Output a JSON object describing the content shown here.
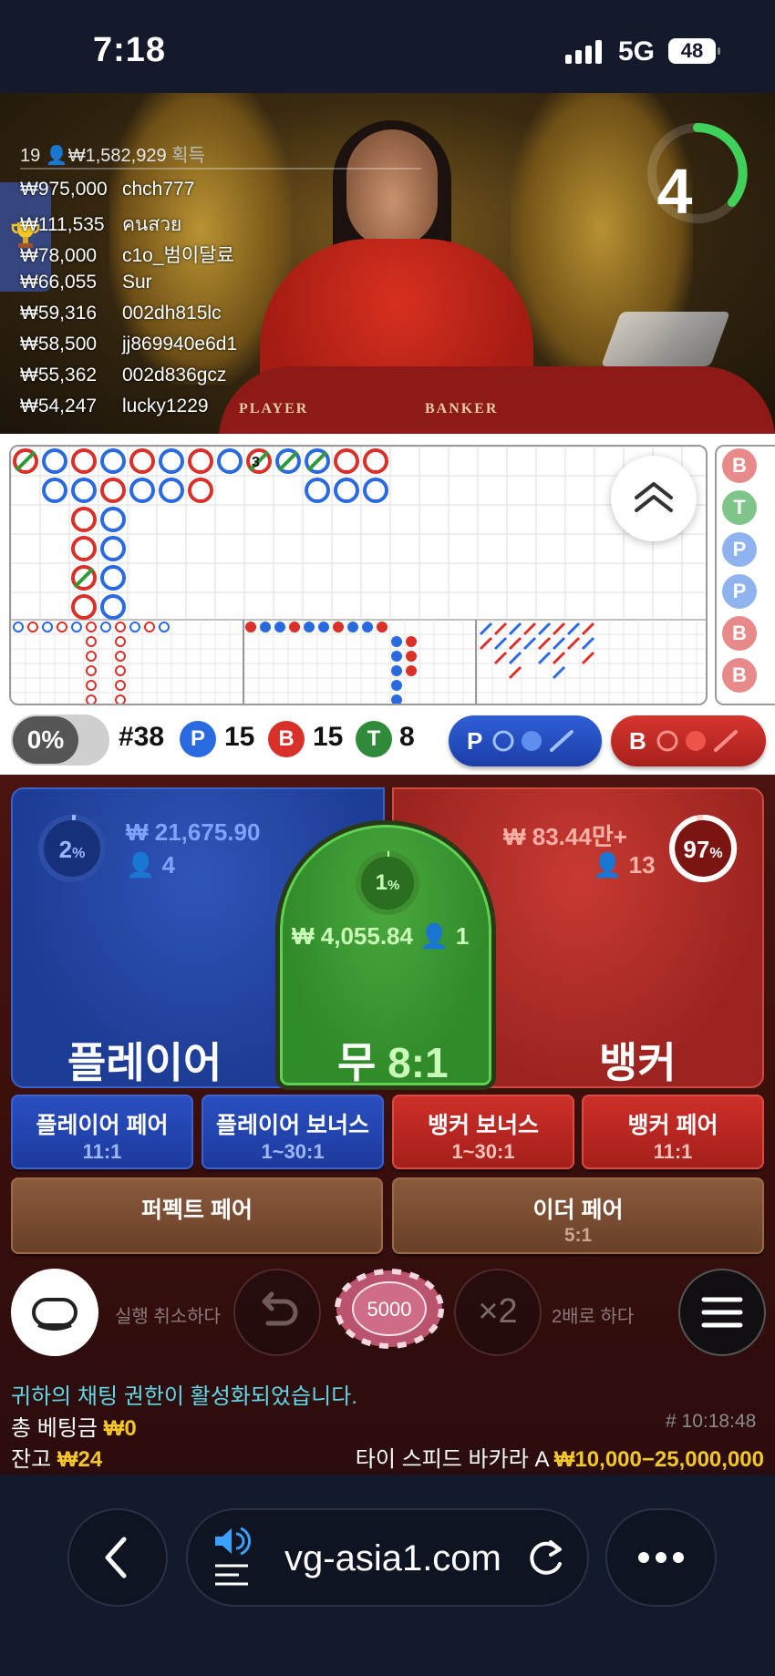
{
  "status_bar": {
    "time": "7:18",
    "network": "5G",
    "battery": "48"
  },
  "video": {
    "winners_header": {
      "count": "19",
      "total": "₩1,582,929",
      "suffix": "획득"
    },
    "winners": [
      {
        "amount": "₩975,000",
        "name": "chch777"
      },
      {
        "amount": "₩111,535",
        "name": "คนสวย"
      },
      {
        "amount": "₩78,000",
        "name": "c1o_범이달료"
      },
      {
        "amount": "₩66,055",
        "name": "Sur"
      },
      {
        "amount": "₩59,316",
        "name": "002dh815lc"
      },
      {
        "amount": "₩58,500",
        "name": "jj869940e6d1"
      },
      {
        "amount": "₩55,362",
        "name": "002d836gcz"
      },
      {
        "amount": "₩54,247",
        "name": "lucky1229"
      }
    ],
    "timer": "4",
    "felt_player": "PLAYER",
    "felt_banker": "BANKER"
  },
  "road": {
    "side_pills": [
      "B",
      "T",
      "P",
      "P",
      "B",
      "B"
    ],
    "tie_number": "3"
  },
  "stats": {
    "toggle": "0%",
    "round": "#38",
    "p_label": "P",
    "p_count": "15",
    "b_label": "B",
    "b_count": "15",
    "t_label": "T",
    "t_count": "8",
    "predict_p": "P",
    "predict_b": "B"
  },
  "bets": {
    "player": {
      "label": "플레이어",
      "pct": "2",
      "amount": "₩ 21,675.90",
      "users": "4"
    },
    "tie": {
      "label": "무",
      "odds": "8:1",
      "pct": "1",
      "amount": "₩ 4,055.84",
      "users": "1"
    },
    "banker": {
      "label": "뱅커",
      "pct": "97",
      "amount": "₩ 83.44만+",
      "users": "13"
    },
    "side": [
      {
        "name": "플레이어 페어",
        "odds": "11:1"
      },
      {
        "name": "플레이어 보너스",
        "odds": "1~30:1"
      },
      {
        "name": "뱅커 보너스",
        "odds": "1~30:1"
      },
      {
        "name": "뱅커 페어",
        "odds": "11:1"
      }
    ],
    "perfect_pair": {
      "name": "퍼펙트 페어"
    },
    "either_pair": {
      "name": "이더 페어",
      "odds": "5:1"
    }
  },
  "controls": {
    "undo_label": "실행 취소하다",
    "chip_value": "5000",
    "double_button": "×2",
    "double_label": "2배로 하다"
  },
  "footer": {
    "chat_notice": "귀하의 채팅 권한이 활성화되었습니다.",
    "total_bet_label": "총 베팅금",
    "total_bet_value": "₩0",
    "balance_label": "잔고",
    "balance_value": "₩24",
    "round_time": "# 10:18:48",
    "table_name": "타이 스피드 바카라 A",
    "table_limit": "₩10,000−25,000,000"
  },
  "browser": {
    "url": "vg-asia1.com"
  },
  "colors": {
    "player": "#2a56c6",
    "banker": "#d32f2a",
    "tie": "#2f8a28",
    "gold": "#f3c728",
    "chat": "#63d6e8"
  }
}
